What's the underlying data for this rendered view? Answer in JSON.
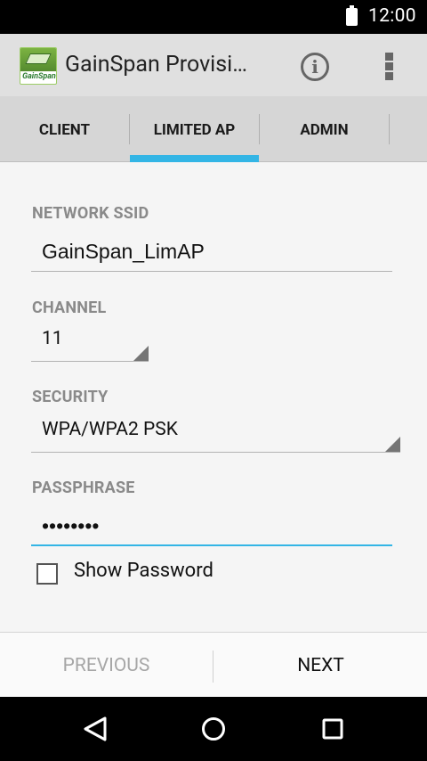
{
  "status_bar": {
    "time": "12:00",
    "battery_icon": "battery-full-icon"
  },
  "action_bar": {
    "title": "GainSpan Provisi…",
    "logo_text": "GainSpan",
    "info_icon": "info-icon",
    "overflow_icon": "overflow-menu-icon"
  },
  "tabs": [
    {
      "label": "CLIENT",
      "selected": false
    },
    {
      "label": "LIMITED AP",
      "selected": true
    },
    {
      "label": "ADMIN",
      "selected": false
    }
  ],
  "colors": {
    "accent": "#33b5e5",
    "label": "#8a8a8a",
    "disabled": "#a6a6a6"
  },
  "form": {
    "ssid": {
      "label": "NETWORK SSID",
      "value": "GainSpan_LimAP"
    },
    "channel": {
      "label": "CHANNEL",
      "value": "11"
    },
    "security": {
      "label": "SECURITY",
      "value": "WPA/WPA2 PSK"
    },
    "passphrase": {
      "label": "PASSPHRASE",
      "value": "••••••••",
      "focused": true
    },
    "show_password": {
      "label": "Show Password",
      "checked": false
    }
  },
  "buttons": {
    "previous": {
      "label": "PREVIOUS",
      "enabled": false
    },
    "next": {
      "label": "NEXT",
      "enabled": true
    }
  },
  "nav_bar": {
    "back_icon": "back-triangle-icon",
    "home_icon": "home-circle-icon",
    "recents_icon": "recents-square-icon"
  }
}
